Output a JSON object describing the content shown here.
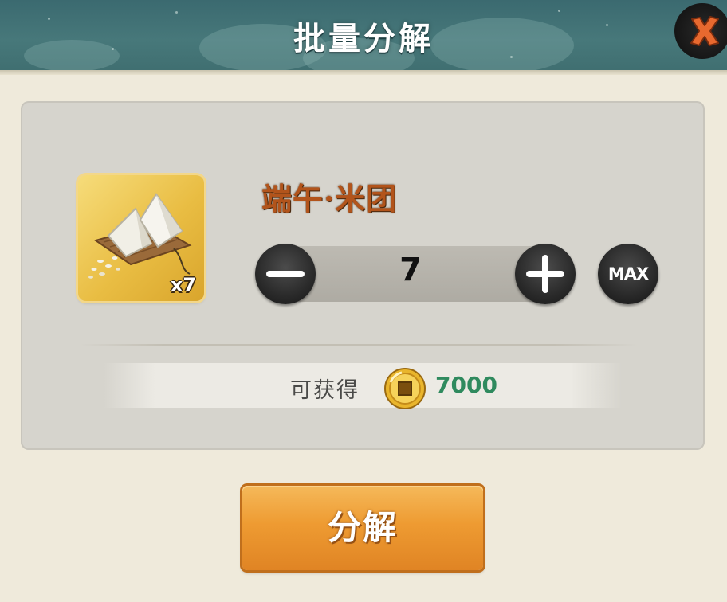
{
  "header": {
    "title": "批量分解"
  },
  "item": {
    "name": "端午·米团",
    "count_badge": "x7",
    "icon": "rice-dumpling-icon"
  },
  "quantity": {
    "value": "7",
    "max_label": "MAX"
  },
  "reward": {
    "label": "可获得",
    "amount": "7000",
    "icon": "copper-coin-icon"
  },
  "actions": {
    "decompose_label": "分解"
  },
  "colors": {
    "header_bg": "#47787a",
    "item_name": "#b2541b",
    "reward_amount": "#2f8a5e",
    "button_orange": "#ee9b32"
  }
}
